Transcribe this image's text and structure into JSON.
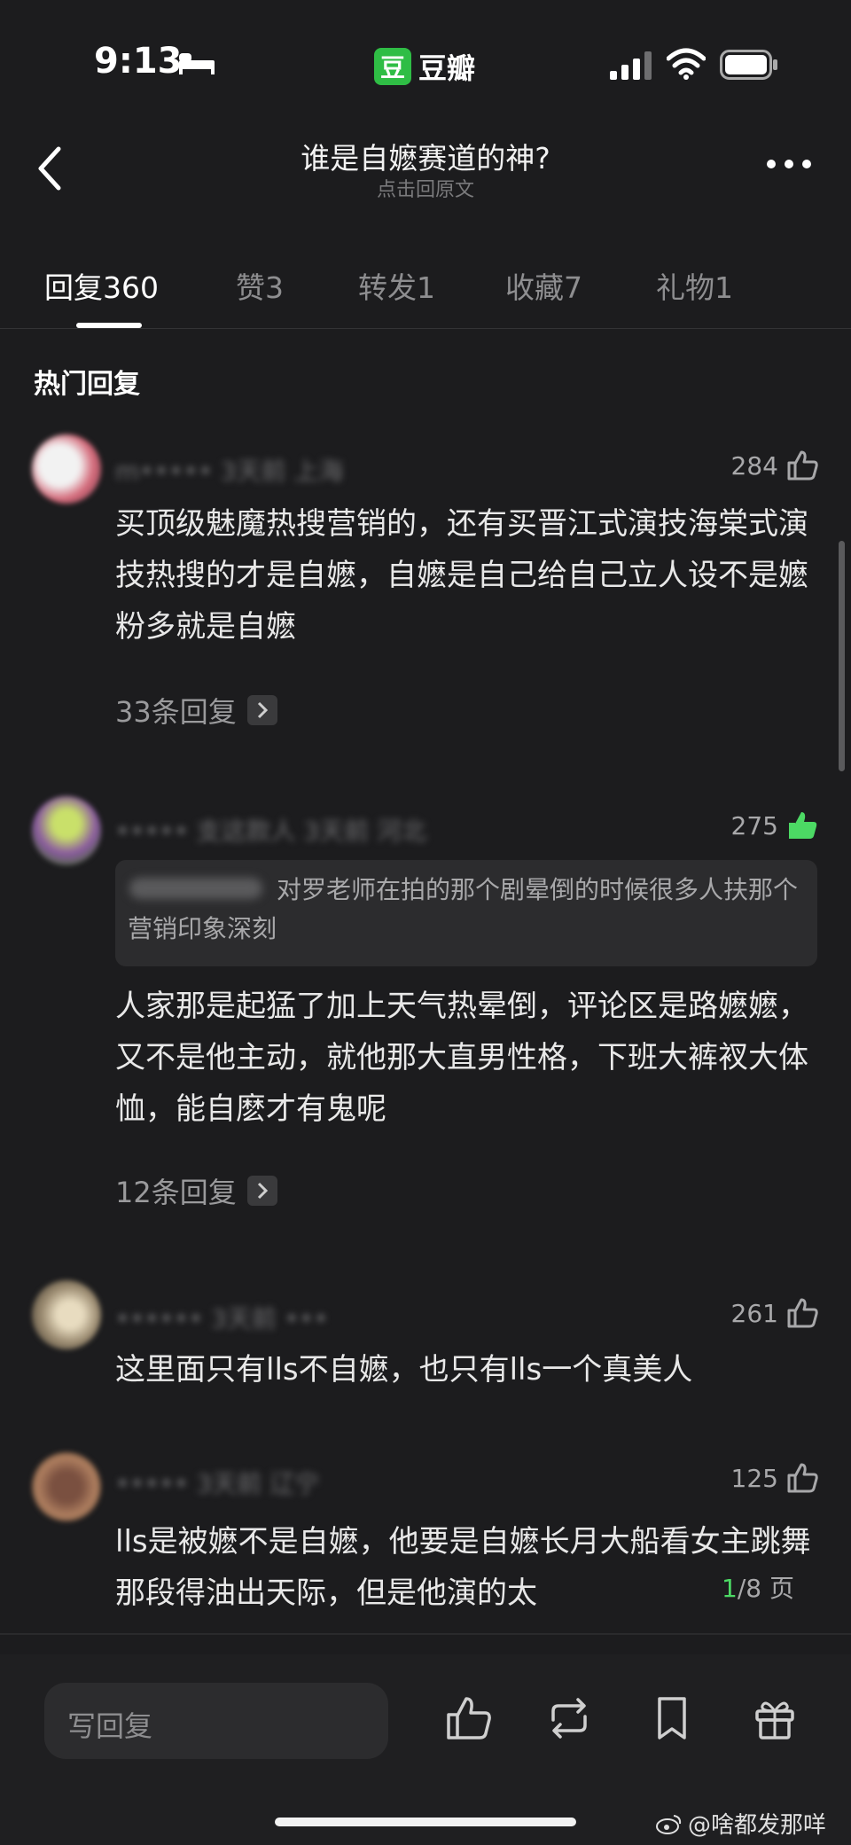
{
  "status": {
    "time": "9:13",
    "app_logo": "豆",
    "app_name": "豆瓣"
  },
  "header": {
    "title": "谁是自嬷赛道的神?",
    "subtitle": "点击回原文"
  },
  "tabs": [
    {
      "label": "回复",
      "count": "360"
    },
    {
      "label": "赞",
      "count": "3"
    },
    {
      "label": "转发",
      "count": "1"
    },
    {
      "label": "收藏",
      "count": "7"
    },
    {
      "label": "礼物",
      "count": "1"
    }
  ],
  "section_title": "热门回复",
  "comments": [
    {
      "meta": "m••••• 3天前 上海",
      "likes": "284",
      "text": "买顶级魅魔热搜营销的，还有买晋江式演技海棠式演技热搜的才是自嬷，自嬷是自己给自己立人设不是嬷粉多就是自嬷",
      "replies": "33条回复"
    },
    {
      "meta": "••••• 支这款人 3天前 河北",
      "likes": "275",
      "quote": "对罗老师在拍的那个剧晕倒的时候很多人扶那个营销印象深刻",
      "text": "人家那是起猛了加上天气热晕倒，评论区是路嬷嬷，又不是他主动，就他那大直男性格，下班大裤衩大体恤，能自麽才有鬼呢",
      "replies": "12条回复"
    },
    {
      "meta": "•••••• 3天前 •••",
      "likes": "261",
      "text": "这里面只有lls不自嬷，也只有lls一个真美人"
    },
    {
      "meta": "••••• 3天前 辽宁",
      "likes": "125",
      "text": "lls是被嬷不是自嬷，他要是自嬷长月大船看女主跳舞那段得油出天际，但是他演的太"
    }
  ],
  "pager": {
    "current": "1",
    "total": "/8 页"
  },
  "bottom": {
    "reply_placeholder": "写回复"
  },
  "watermark": "@啥都发那咩",
  "colors": {
    "accent_green": "#4cd964",
    "background": "#1c1c1e",
    "douban_green": "#2fbd45"
  }
}
